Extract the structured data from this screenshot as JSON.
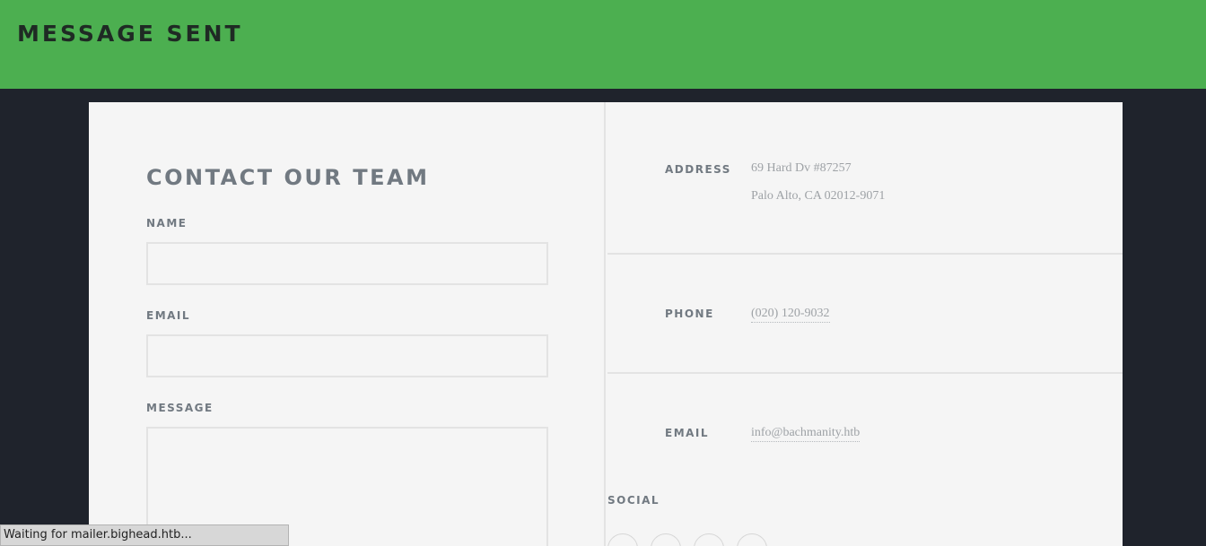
{
  "header": {
    "title": "MESSAGE SENT"
  },
  "form": {
    "title": "CONTACT OUR TEAM",
    "name_label": "NAME",
    "name_value": "",
    "email_label": "EMAIL",
    "email_value": "",
    "message_label": "MESSAGE",
    "message_value": ""
  },
  "info": {
    "address_label": "ADDRESS",
    "address_line1": "69 Hard Dv #87257",
    "address_line2": "Palo Alto, CA 02012-9071",
    "phone_label": "PHONE",
    "phone_value": "(020) 120-9032",
    "email_label": "EMAIL",
    "email_value": "info@bachmanity.htb",
    "social_label": "SOCIAL",
    "social_icons": [
      "social-icon-1",
      "social-icon-2",
      "social-icon-3",
      "social-icon-4"
    ]
  },
  "status": {
    "text": "Waiting for mailer.bighead.htb..."
  },
  "colors": {
    "header_bg": "#4caf50",
    "page_bg": "#1f232c",
    "card_bg": "#f5f5f5",
    "label_text": "#717981",
    "value_text": "#9ea2a6"
  }
}
